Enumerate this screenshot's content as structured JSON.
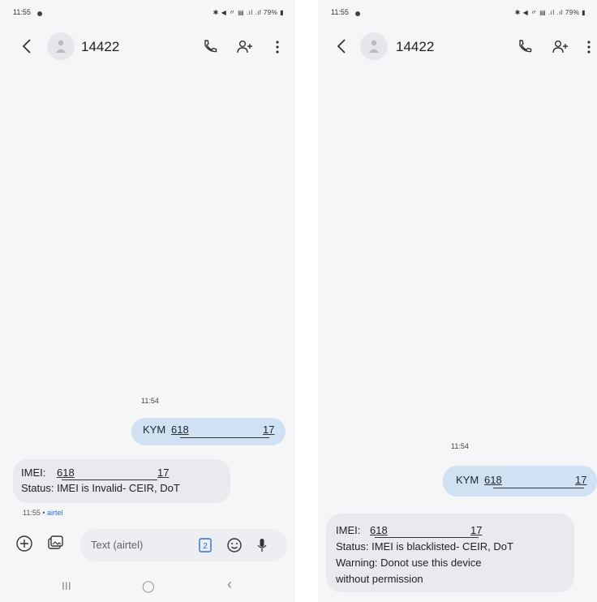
{
  "left": {
    "status_time": "11:55",
    "status_right": "✱ ◀ 〃 ▤ .ıl .ıl 79% ▮",
    "contact": "14422",
    "timestamp": "11:54",
    "sent": {
      "prefix": "KYM",
      "num1": "618",
      "num2": "17"
    },
    "received": {
      "label": "IMEI:",
      "num1": "618",
      "num2": "17",
      "status": "Status: IMEI is Invalid- CEIR, DoT"
    },
    "meta_time": "11:55",
    "meta_sep": " • ",
    "meta_carrier": "airtel",
    "composer_placeholder": "Text (airtel)",
    "nav_recents": "III",
    "nav_home": "◯",
    "nav_back": "‹"
  },
  "right": {
    "status_time": "11:55",
    "status_right": "✱ ◀ 〃 ▤ .ıl .ıl 79% ▮",
    "contact": "14422",
    "timestamp": "11:54",
    "sent": {
      "prefix": "KYM",
      "num1": "618",
      "num2": "17"
    },
    "received": {
      "label": "IMEI:",
      "num1": "618",
      "num2": "17",
      "status": "Status: IMEI is blacklisted- CEIR, DoT",
      "warning1": "Warning: Donot use this device",
      "warning2": "without permission"
    }
  }
}
